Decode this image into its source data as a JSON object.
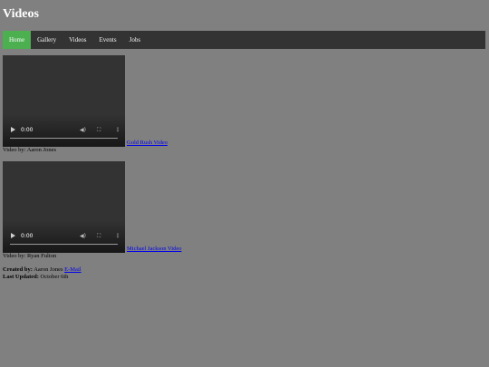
{
  "page": {
    "title": "Videos"
  },
  "nav": {
    "items": [
      {
        "label": "Home",
        "active": true
      },
      {
        "label": "Gallery",
        "active": false
      },
      {
        "label": "Videos",
        "active": false
      },
      {
        "label": "Events",
        "active": false
      },
      {
        "label": "Jobs",
        "active": false
      }
    ],
    "active_color": "#4caf50",
    "bar_color": "#333333"
  },
  "videos": [
    {
      "time": "0:00",
      "link_text": "Gold Rush Video",
      "credit": "Video by: Aaron Jones"
    },
    {
      "time": "0:00",
      "link_text": "Michael Jackson Video",
      "credit": "Video by: Ryan Fulton"
    }
  ],
  "player_icons": {
    "play": "play-icon",
    "volume": "volume-icon",
    "fullscreen": "fullscreen-icon",
    "more": "more-vertical-icon"
  },
  "footer": {
    "created_label": "Created by:",
    "created_value": " Aaron Jones ",
    "email_link": "E-Mail",
    "updated_label": "Last Updated:",
    "updated_value": " October 6th"
  }
}
